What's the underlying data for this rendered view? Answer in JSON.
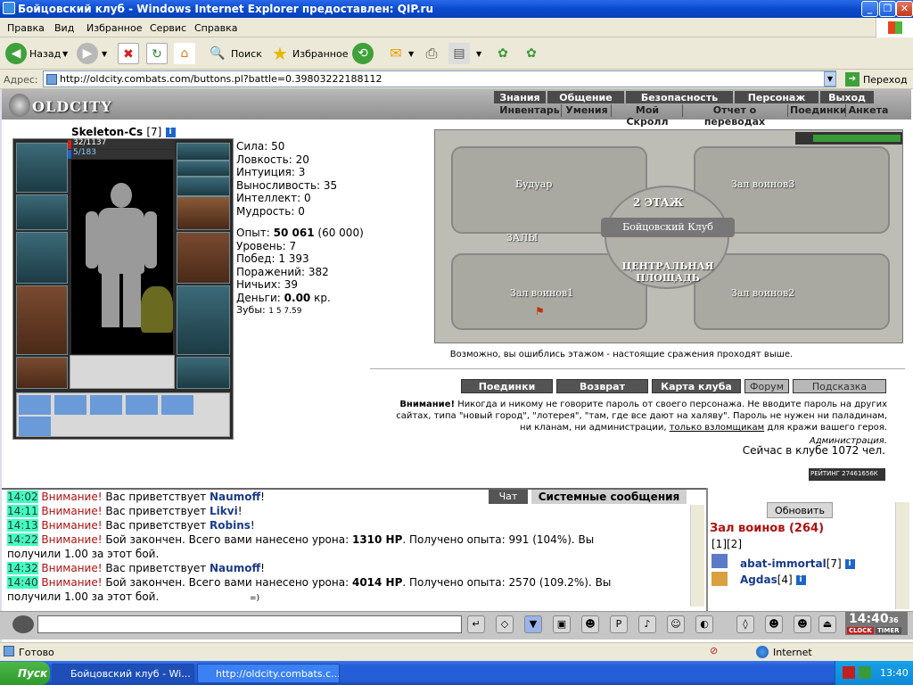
{
  "window": {
    "title": "Бойцовский клуб - Windows Internet Explorer предоставлен: QIP.ru"
  },
  "menu": [
    "Правка",
    "Вид",
    "Избранное",
    "Сервис",
    "Справка"
  ],
  "toolbar": {
    "back": "Назад",
    "search": "Поиск",
    "favorites": "Избранное"
  },
  "address": {
    "label": "Адрес:",
    "url": "http://oldcity.combats.com/buttons.pl?battle=0.39803222188112",
    "go": "Переход"
  },
  "game": {
    "logo": "OLDCITY",
    "nav_top": [
      "Знания",
      "Общение",
      "Безопасность",
      "Персонаж",
      "Выход"
    ],
    "nav_sub": [
      "Инвентарь",
      "Умения",
      "Мой Скролл",
      "Отчет о переводах",
      "Поединки",
      "Анкета"
    ]
  },
  "character": {
    "name": "Skeleton-Cs",
    "level": "[7]",
    "hp": "32/1137",
    "mana": "5/183",
    "stats": [
      {
        "label": "Сила:",
        "value": "50"
      },
      {
        "label": "Ловкость:",
        "value": "20"
      },
      {
        "label": "Интуиция:",
        "value": "3"
      },
      {
        "label": "Выносливость:",
        "value": "35"
      },
      {
        "label": "Интеллект:",
        "value": "0"
      },
      {
        "label": "Мудрость:",
        "value": "0"
      }
    ],
    "exp_label": "Опыт:",
    "exp_value": "50 061",
    "exp_next": "(60 000)",
    "level_label": "Уровень:",
    "level_value": "7",
    "wins_label": "Побед:",
    "wins_value": "1 393",
    "losses_label": "Поражений:",
    "losses_value": "382",
    "draws_label": "Ничьих:",
    "draws_value": "39",
    "money_label": "Деньги:",
    "money_value": "0.00",
    "money_unit": "кр.",
    "teeth_label": "Зубы:",
    "teeth_values": "1 5 7.59"
  },
  "map": {
    "floor": "2 ЭТАЖ",
    "club": "Бойцовский Клуб",
    "halls": "ЗАЛЫ",
    "central": "ЦЕНТРАЛЬНАЯ ПЛОЩАДЬ",
    "rooms": [
      "Будуар",
      "Зал воинов3",
      "Зал воинов1",
      "Зал воинов2"
    ],
    "note": "Возможно, вы ошиблись этажом - настоящие сражения проходят выше."
  },
  "buttons": [
    "Поединки",
    "Возврат",
    "Карта клуба",
    "Форум",
    "Подсказка"
  ],
  "warning": {
    "bold": "Внимание!",
    "text": " Никогда и никому не говорите пароль от своего персонажа. Не вводите пароль на других сайтах, типа \"новый город\", \"лотерея\", \"там, где все дают на халяву\". Пароль не нужен ни паладинам, ни кланам, ни администрации, ",
    "link": "только взломщикам",
    "tail": " для кражи вашего героя.",
    "signature": "Администрация."
  },
  "online": "Сейчас в клубе 1072 чел.",
  "rating": "РЕЙТИНГ 27461656К",
  "chat": {
    "tabs": [
      "Чат",
      "Системные сообщения"
    ],
    "lines": [
      {
        "time": "14:02",
        "warn": "Внимание!",
        "text": " Вас приветствует ",
        "nick": "Naumoff",
        "end": "!"
      },
      {
        "time": "14:11",
        "warn": "Внимание!",
        "text": " Вас приветствует ",
        "nick": "Likvi",
        "end": "!"
      },
      {
        "time": "14:13",
        "warn": "Внимание!",
        "text": " Вас приветствует ",
        "nick": "Robins",
        "end": "!"
      },
      {
        "time": "14:22",
        "warn": "Внимание!",
        "text": " Бой закончен. Всего вами нанесено урона: ",
        "nick": "1310 HP",
        "end": ". Получено опыта: 991 (104%). Вы"
      },
      {
        "time": "",
        "warn": "",
        "text": "получили 1.00 за этот бой.",
        "nick": "",
        "end": ""
      },
      {
        "time": "14:32",
        "warn": "Внимание!",
        "text": " Вас приветствует ",
        "nick": "Naumoff",
        "end": "!"
      },
      {
        "time": "14:40",
        "warn": "Внимание!",
        "text": " Бой закончен. Всего вами нанесено урона: ",
        "nick": "4014 HP",
        "end": ". Получено опыта: 2570 (109.2%). Вы"
      },
      {
        "time": "",
        "warn": "",
        "text": "получили 1.00 за этот бой.",
        "nick": "",
        "end": ""
      }
    ],
    "input_smiley": "=)"
  },
  "side": {
    "refresh": "Обновить",
    "room": "Зал воинов (264)",
    "pages": "[1][2]",
    "users": [
      {
        "name": "abat-immortal",
        "level": "[7]"
      },
      {
        "name": "Agdas",
        "level": "[4]"
      }
    ]
  },
  "clock": "14:40",
  "clock_sec": "36",
  "clock_labels": [
    "CLOCK",
    "TIMER"
  ],
  "statusbar": {
    "text": "Готово",
    "zone": "Internet"
  },
  "taskbar": {
    "start": "Пуск",
    "tasks": [
      "Бойцовский клуб - Wi...",
      "http://oldcity.combats.c..."
    ],
    "time": "13:40"
  }
}
